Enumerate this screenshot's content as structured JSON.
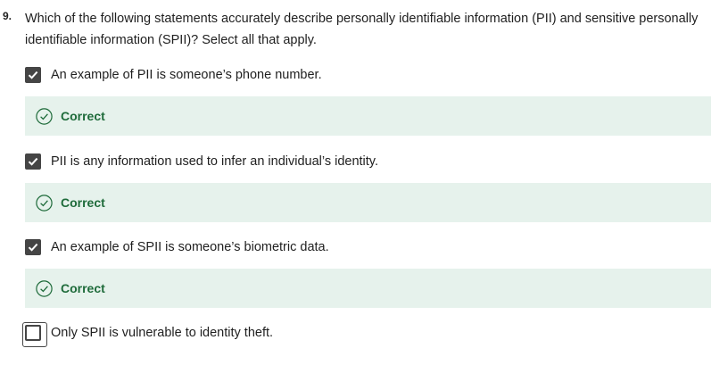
{
  "question": {
    "number": "9.",
    "text": "Which of the following statements accurately describe personally identifiable information (PII) and sensitive personally identifiable information (SPII)? Select all that apply."
  },
  "options": [
    {
      "label": "An example of PII is someone’s phone number.",
      "checked": true,
      "feedback": "Correct"
    },
    {
      "label": "PII is any information used to infer an individual’s identity.",
      "checked": true,
      "feedback": "Correct"
    },
    {
      "label": "An example of SPII is someone’s biometric data.",
      "checked": true,
      "feedback": "Correct"
    },
    {
      "label": "Only SPII is vulnerable to identity theft.",
      "checked": false,
      "feedback": ""
    }
  ],
  "colors": {
    "checkbox": "#454545",
    "feedback_bg": "#e6f2ec",
    "feedback_text": "#1e6b3a"
  },
  "icons": {
    "checked": "checkmark-icon",
    "feedback": "check-circle-icon"
  }
}
